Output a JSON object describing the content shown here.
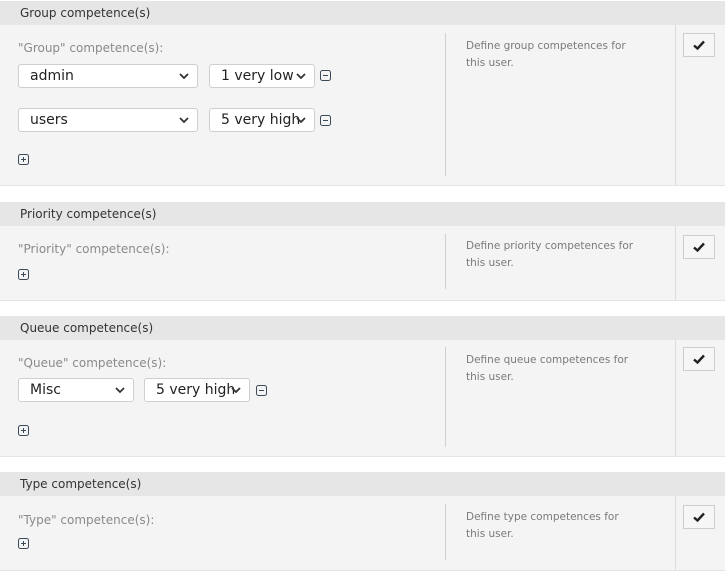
{
  "sections": [
    {
      "title": "Group competence(s)",
      "field_label": "\"Group\" competence(s):",
      "description": "Define group competences for this user.",
      "rows": [
        {
          "item": "admin",
          "level": "1 very low"
        },
        {
          "item": "users",
          "level": "5 very high"
        }
      ]
    },
    {
      "title": "Priority competence(s)",
      "field_label": "\"Priority\" competence(s):",
      "description": "Define priority competences for this user.",
      "rows": []
    },
    {
      "title": "Queue competence(s)",
      "field_label": "\"Queue\" competence(s):",
      "description": "Define queue competences for this user.",
      "rows": [
        {
          "item": "Misc",
          "level": "5 very high"
        }
      ]
    },
    {
      "title": "Type competence(s)",
      "field_label": "\"Type\" competence(s):",
      "description": "Define type competences for this user.",
      "rows": []
    }
  ],
  "icons": {
    "save": "checkmark-icon",
    "add": "plus-square-icon",
    "remove": "minus-square-icon",
    "dropdown": "chevron-down-icon"
  }
}
